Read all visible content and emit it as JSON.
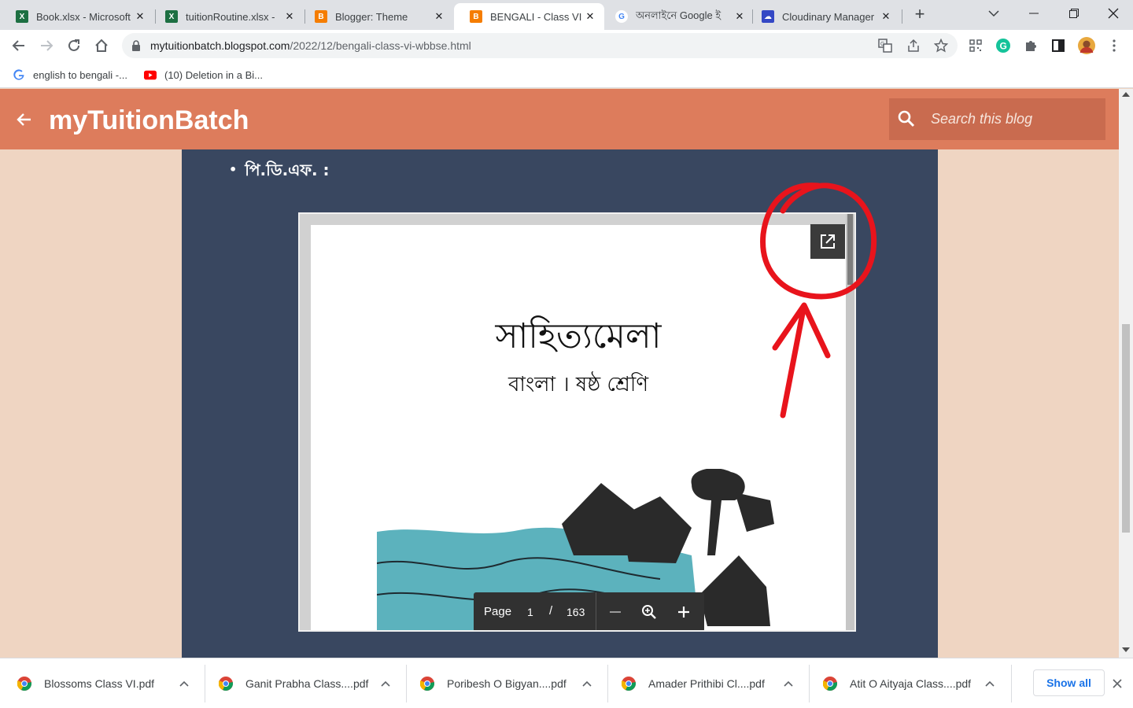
{
  "tabs": [
    {
      "title": "Book.xlsx - Microsoft",
      "icon": "excel-icon"
    },
    {
      "title": "tuitionRoutine.xlsx -",
      "icon": "excel-icon"
    },
    {
      "title": "Blogger: Theme",
      "icon": "blogger-icon"
    },
    {
      "title": "BENGALI - Class VI -",
      "icon": "blogger-icon",
      "active": true
    },
    {
      "title": "অনলাইনে Google ই",
      "icon": "google-icon"
    },
    {
      "title": "Cloudinary Manager",
      "icon": "cloudinary-icon"
    }
  ],
  "tab_close_glyph": "✕",
  "new_tab_glyph": "+",
  "address": {
    "host": "mytuitionbatch.blogspot.com",
    "path": "/2022/12/bengali-class-vi-wbbse.html"
  },
  "bookmarks": [
    {
      "label": "english to bengali -...",
      "icon": "google-icon"
    },
    {
      "label": "(10) Deletion in a Bi...",
      "icon": "youtube-icon"
    }
  ],
  "blog": {
    "title": "myTuitionBatch",
    "search_placeholder": "Search this blog"
  },
  "content": {
    "bullet_text": "পি.ডি.এফ. :"
  },
  "pdf": {
    "title": "সাহিত্যমেলা",
    "subtitle": "বাংলা । ষষ্ঠ শ্রেণি",
    "page_label": "Page",
    "current_page": "1",
    "separator": "/",
    "total_pages": "163"
  },
  "downloads": [
    {
      "name": "Blossoms Class VI.pdf"
    },
    {
      "name": "Ganit Prabha Class....pdf"
    },
    {
      "name": "Poribesh O Bigyan....pdf"
    },
    {
      "name": "Amader Prithibi Cl....pdf"
    },
    {
      "name": "Atit O Aityaja Class....pdf"
    }
  ],
  "show_all_label": "Show all",
  "colors": {
    "header": "#dd7c5c",
    "content_bg": "#394760",
    "page_bg": "#efd5c2",
    "annotation": "#e8141c"
  }
}
